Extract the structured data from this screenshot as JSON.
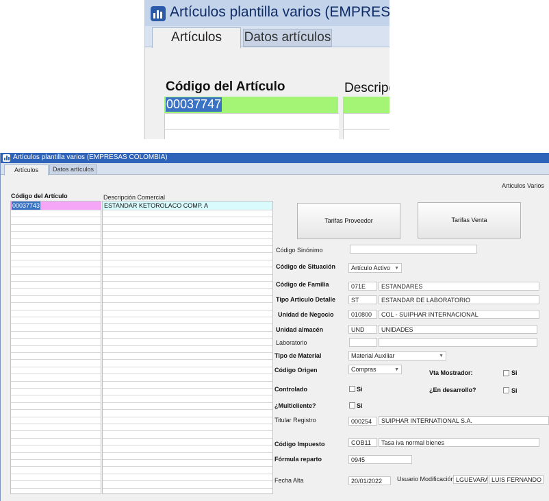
{
  "window": {
    "title": "Artículos plantilla varios (EMPRESAS COLOMBIA)",
    "zoom_title": "Artículos plantilla varios (EMPRESAS",
    "tabs": [
      "Artículos",
      "Datos artículos"
    ]
  },
  "grid": {
    "col_code_header": "Código del Artículo",
    "col_desc_header": "Descripción Comercial",
    "zoom_desc_header": "Descripci",
    "rows": [
      {
        "code": "00037743",
        "desc": "ESTANDAR KETOROLACO COMP. A"
      }
    ],
    "zoom_code": "00037747",
    "colors": {
      "code_cell": "#f5a6f7",
      "desc_cell": "#d9fbfd",
      "zoom_highlight": "#a4f576",
      "selection": "#3b73c4"
    }
  },
  "form": {
    "section_title": "Articulos Varios",
    "buttons": {
      "tarifas_proveedor": "Tarifas Proveedor",
      "tarifas_venta": "Tarifas Venta"
    },
    "codigo_sinonimo": {
      "label": "Código Sinónimo",
      "value": ""
    },
    "codigo_situacion": {
      "label": "Código de Situación",
      "value": "Artículo Activo"
    },
    "codigo_familia": {
      "label": "Código de Familia",
      "code": "071E",
      "desc": "ESTANDARES"
    },
    "tipo_articulo": {
      "label": "Tipo Articulo Detalle",
      "code": "ST",
      "desc": "ESTANDAR DE LABORATORIO"
    },
    "unidad_negocio": {
      "label": "Unidad de Negocio",
      "code": "010800",
      "desc": "COL - SUIPHAR INTERNACIONAL"
    },
    "unidad_almacen": {
      "label": "Unidad almacén",
      "code": "UND",
      "desc": "UNIDADES"
    },
    "laboratorio": {
      "label": "Laboratorio",
      "code": "",
      "desc": ""
    },
    "tipo_material": {
      "label": "Tipo de Material",
      "value": "Material Auxiliar"
    },
    "codigo_origen": {
      "label": "Código Origen",
      "value": "Compras"
    },
    "vta_mostrador": {
      "label": "Vta Mostrador:",
      "check_label": "Si"
    },
    "controlado": {
      "label": "Controlado",
      "check_label": "Si"
    },
    "en_desarrollo": {
      "label": "¿En desarrollo?",
      "check_label": "Si"
    },
    "multicliente": {
      "label": "¿Multicliente?",
      "check_label": "Si"
    },
    "titular_registro": {
      "label": "Titular Registro",
      "code": "000254",
      "desc": "SUIPHAR INTERNATIONAL S.A."
    },
    "codigo_impuesto": {
      "label": "Código Impuesto",
      "code": "COB11",
      "desc": "Tasa iva normal bienes"
    },
    "formula_reparto": {
      "label": "Fórmula reparto",
      "value": "0945"
    },
    "fecha_alta": {
      "label": "Fecha Alta",
      "value": "20/01/2022"
    },
    "usuario_mod": {
      "label": "Usuario Modificación",
      "code": "LGUEVARA",
      "name": "LUIS FERNANDO GL"
    }
  }
}
